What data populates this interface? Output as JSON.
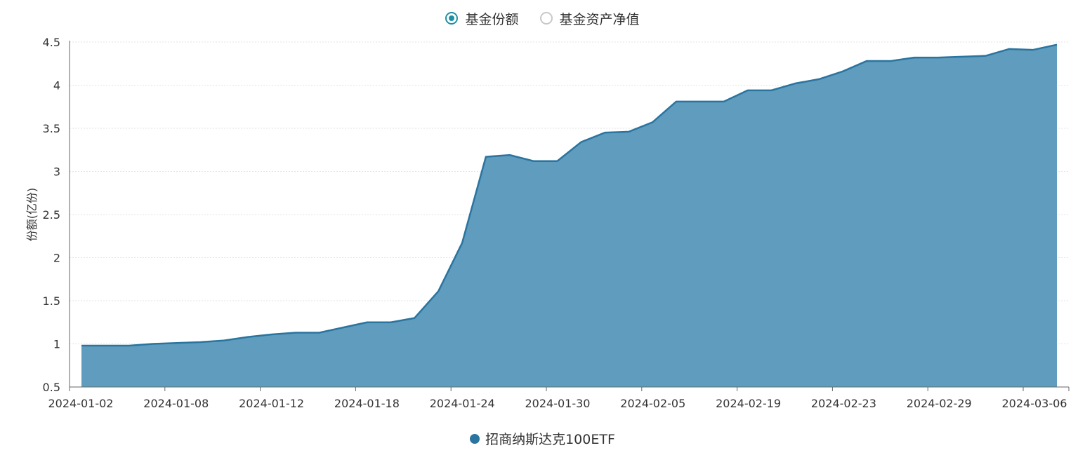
{
  "toggle": {
    "options": [
      {
        "label": "基金份额",
        "selected": true
      },
      {
        "label": "基金资产净值",
        "selected": false
      }
    ]
  },
  "colors": {
    "area": "#5f9cbd",
    "line": "#2a74a0",
    "radio_active": "#1f8fa6",
    "legend": "#2a74a0"
  },
  "chart_data": {
    "type": "area",
    "ylabel": "份额(亿份)",
    "xlabel": "",
    "ylim": [
      0.5,
      4.5
    ],
    "yticks": [
      0.5,
      1,
      1.5,
      2,
      2.5,
      3,
      3.5,
      4,
      4.5
    ],
    "xtick_labels": [
      "2024-01-02",
      "2024-01-08",
      "2024-01-12",
      "2024-01-18",
      "2024-01-24",
      "2024-01-30",
      "2024-02-05",
      "2024-02-19",
      "2024-02-23",
      "2024-02-29",
      "2024-03-06"
    ],
    "grid": true,
    "legend_position": "bottom",
    "series": [
      {
        "name": "招商纳斯达克100ETF",
        "values": [
          0.98,
          0.98,
          0.98,
          1.0,
          1.01,
          1.02,
          1.04,
          1.08,
          1.11,
          1.13,
          1.13,
          1.19,
          1.25,
          1.25,
          1.3,
          1.61,
          2.17,
          3.17,
          3.19,
          3.12,
          3.12,
          3.34,
          3.45,
          3.46,
          3.57,
          3.81,
          3.81,
          3.81,
          3.94,
          3.94,
          4.02,
          4.07,
          4.16,
          4.28,
          4.28,
          4.32,
          4.32,
          4.33,
          4.34,
          4.42,
          4.41,
          4.47
        ]
      }
    ]
  }
}
